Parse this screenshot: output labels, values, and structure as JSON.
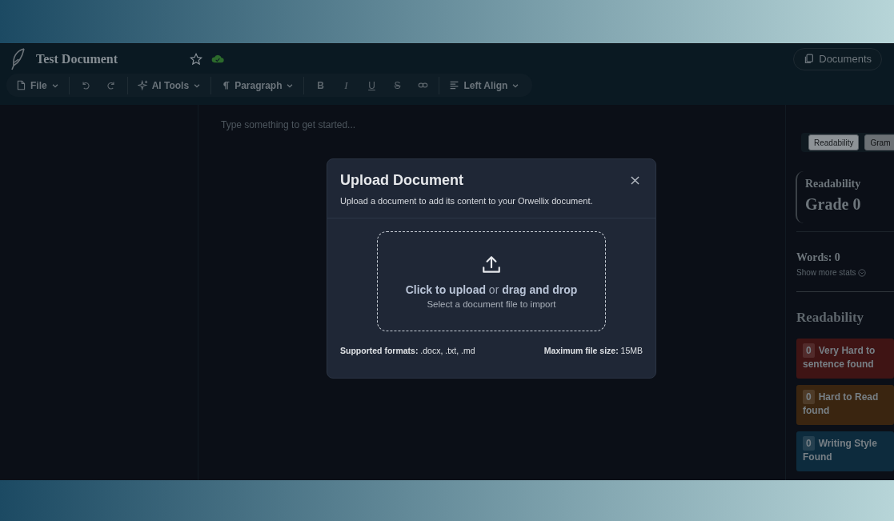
{
  "header": {
    "title": "Test Document",
    "starred": false,
    "documents_button": "Documents"
  },
  "toolbar": [
    {
      "kind": "file",
      "label": "File"
    },
    {
      "kind": "divider"
    },
    {
      "kind": "undo"
    },
    {
      "kind": "redo"
    },
    {
      "kind": "divider"
    },
    {
      "kind": "ai",
      "label": "AI Tools"
    },
    {
      "kind": "divider"
    },
    {
      "kind": "paragraph",
      "label": "Paragraph"
    },
    {
      "kind": "divider"
    },
    {
      "kind": "bold",
      "label": "B"
    },
    {
      "kind": "italic",
      "label": "I"
    },
    {
      "kind": "underline",
      "label": "U"
    },
    {
      "kind": "strike",
      "label": "S"
    },
    {
      "kind": "link"
    },
    {
      "kind": "divider"
    },
    {
      "kind": "align",
      "label": "Left Align"
    }
  ],
  "editor": {
    "placeholder": "Type something to get started..."
  },
  "side_panel": {
    "tabs": [
      {
        "label": "Readability",
        "selected": true
      },
      {
        "label": "Gram",
        "selected": false
      }
    ],
    "score": {
      "label": "Readability",
      "value": "Grade 0"
    },
    "words": "Words: 0",
    "more_stats": "Show more stats",
    "heading": "Readability",
    "issues": [
      {
        "count": "0",
        "lines": [
          "Very Hard to",
          "sentence found"
        ],
        "color": "#3f1414"
      },
      {
        "count": "0",
        "lines": [
          "Hard to Read",
          "found"
        ],
        "color": "#3a2510"
      },
      {
        "count": "0",
        "lines": [
          "Writing Style",
          "Found"
        ],
        "color": "#0d2b3d"
      }
    ]
  },
  "dialog": {
    "title": "Upload Document",
    "subtitle": "Upload a document to add its content to your Orwellix document.",
    "dropzone": {
      "prompt": "**Click to upload** or **drag and drop**",
      "hint": "Select a document file to import"
    },
    "formats": "**Supported formats:** .docx, .txt, .md",
    "max_size": "**Maximum file size:** 15MB"
  }
}
